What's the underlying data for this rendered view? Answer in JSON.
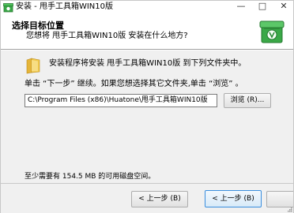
{
  "window": {
    "title": "安装 - 甩手工具箱WIN10版",
    "controls": {
      "minimize": "—",
      "maximize": "□",
      "close": "✕"
    }
  },
  "header": {
    "title": "选择目标位置",
    "subtitle": "您想将 甩手工具箱WIN10版 安装在什么地方?",
    "logo_icon": "green-box-installer-icon"
  },
  "body": {
    "intro": "安装程序将安装 甩手工具箱WIN10版 到下列文件夹中。",
    "instruction": "单击 “下一步” 继续。如果您想选择其它文件夹,单击 “浏览” 。",
    "path_value": "C:\\Program Files (x86)\\Huatone\\甩手工具箱WIN10版",
    "browse_label": "浏览 (R)...",
    "space_required": "至少需要有 154.5 MB 的可用磁盘空间。"
  },
  "footer": {
    "back_label": "< 上一步 (B)",
    "next_label": "< 上一步 (B)"
  },
  "colors": {
    "logo_green": "#3aa847",
    "folder_yellow": "#f0c84a",
    "accent_border": "#3a8ede"
  }
}
